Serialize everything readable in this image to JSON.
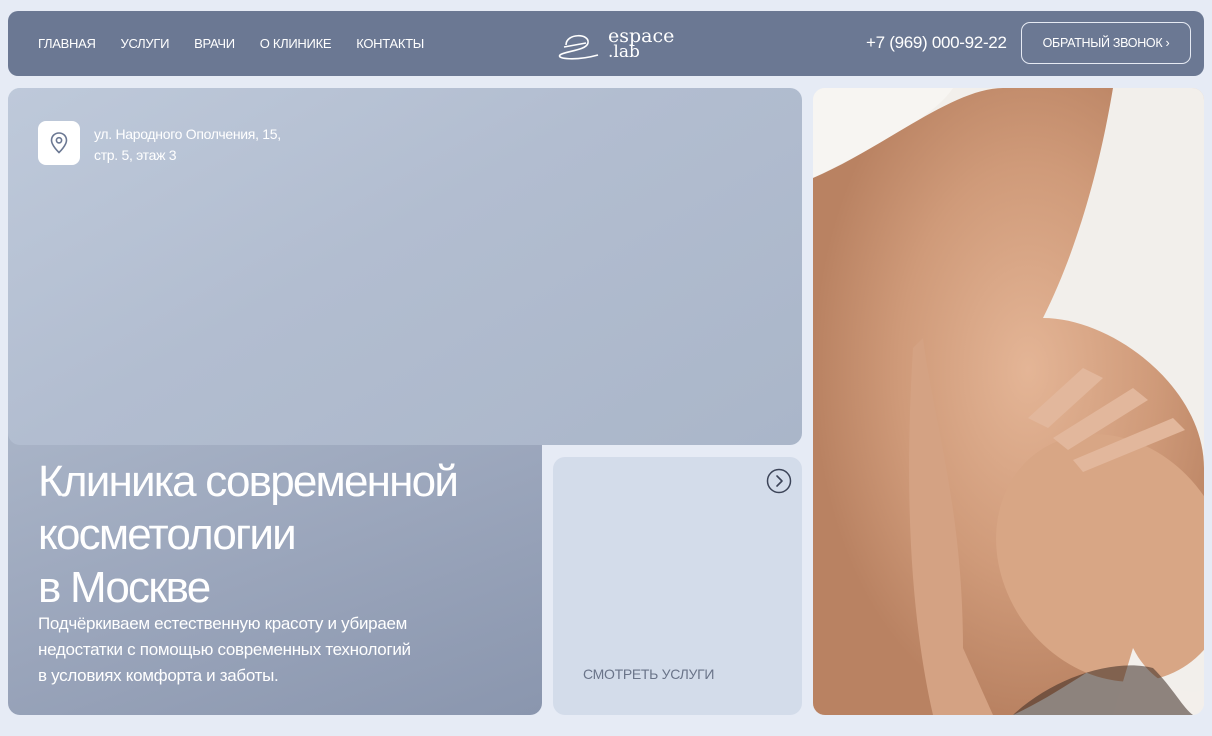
{
  "header": {
    "nav": [
      "ГЛАВНАЯ",
      "УСЛУГИ",
      "ВРАЧИ",
      "О КЛИНИКЕ",
      "КОНТАКТЫ"
    ],
    "logo_top": "espace",
    "logo_bottom": ".lab",
    "phone": "+7 (969) 000-92-22",
    "cta": "ОБРАТНЫЙ ЗВОНОК ›"
  },
  "hero": {
    "address_line1": "ул. Народного Ополчения, 15,",
    "address_line2": "стр. 5, этаж 3",
    "title_line1": "Клиника современной",
    "title_line2": "косметологии",
    "title_line3": "в Москве",
    "subtitle_line1": "Подчёркиваем естественную красоту и убираем",
    "subtitle_line2": "недостатки с помощью современных технологий",
    "subtitle_line3": "в условиях комфорта и заботы."
  },
  "services_card": {
    "label": "СМОТРЕТЬ УСЛУГИ"
  },
  "icons": {
    "pin": "map-pin-icon",
    "arrow": "chevron-right-circle-icon"
  },
  "colors": {
    "header_bg": "#6b7893",
    "page_bg": "#e6ebf5",
    "card_bg": "#d3dcea"
  }
}
